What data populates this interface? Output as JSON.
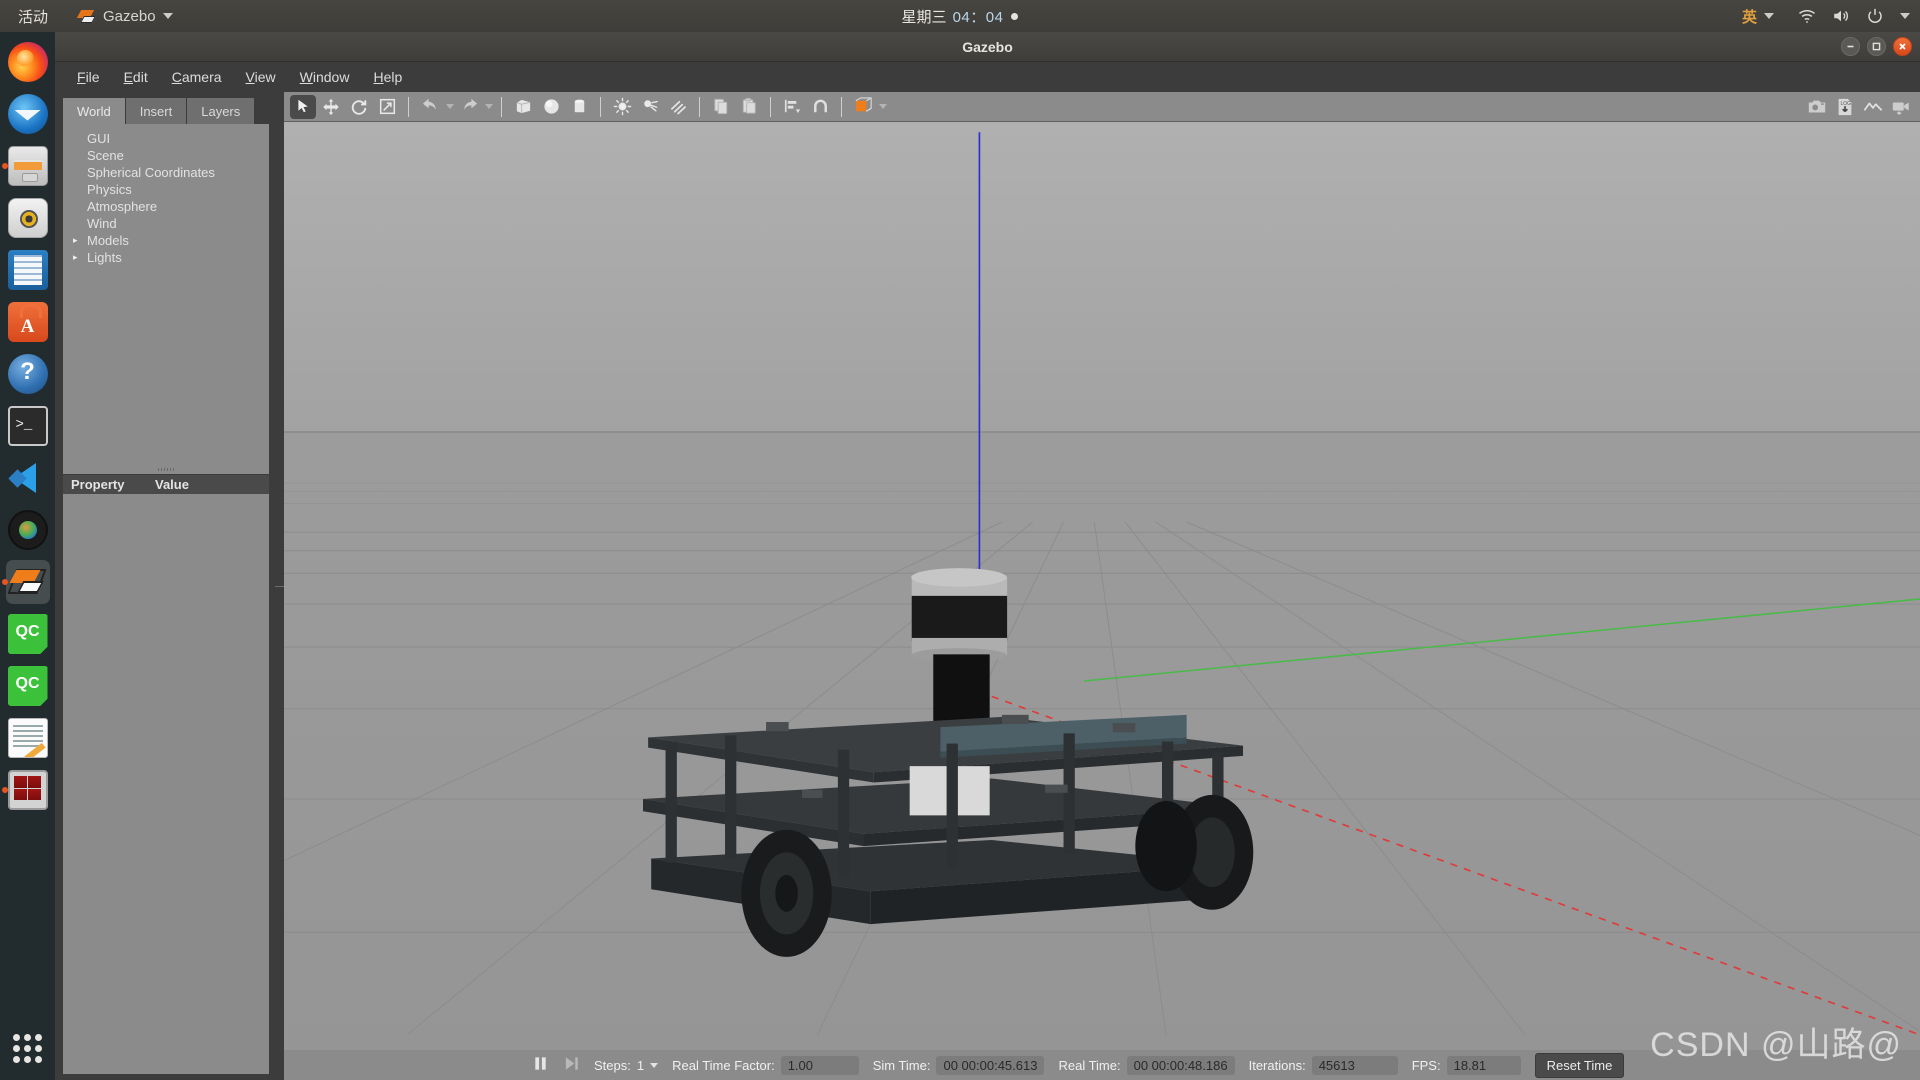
{
  "topbar": {
    "activities": "活动",
    "app_name": "Gazebo",
    "app_icon": "gazebo-icon",
    "clock_date": "星期三",
    "clock_time": "04：04",
    "notification_indicator": "notification-dot",
    "input_method": "英",
    "tray_icons": [
      "wifi-icon",
      "volume-icon",
      "power-icon"
    ],
    "bg_color": "#474540"
  },
  "dock": {
    "items": [
      {
        "name": "firefox",
        "label": "Firefox",
        "running": false,
        "active": false
      },
      {
        "name": "thunderbird",
        "label": "Thunderbird Mail",
        "running": false,
        "active": false
      },
      {
        "name": "files",
        "label": "Files",
        "running": true,
        "active": false
      },
      {
        "name": "rhythmbox",
        "label": "Rhythmbox",
        "running": false,
        "active": false
      },
      {
        "name": "libreoffice-writer",
        "label": "LibreOffice Writer",
        "running": false,
        "active": false
      },
      {
        "name": "ubuntu-software",
        "label": "Ubuntu Software",
        "running": false,
        "active": false
      },
      {
        "name": "help",
        "label": "Help",
        "running": false,
        "active": false
      },
      {
        "name": "terminal",
        "label": "Terminal",
        "running": false,
        "active": false
      },
      {
        "name": "vscode",
        "label": "Visual Studio Code",
        "running": false,
        "active": false
      },
      {
        "name": "camera",
        "label": "Cheese Webcam",
        "running": false,
        "active": false
      },
      {
        "name": "gazebo",
        "label": "Gazebo",
        "running": true,
        "active": true
      },
      {
        "name": "qc-1",
        "label": "QC",
        "running": false,
        "active": false
      },
      {
        "name": "qc-2",
        "label": "QC",
        "running": false,
        "active": false
      },
      {
        "name": "notes",
        "label": "Text Editor",
        "running": false,
        "active": false
      },
      {
        "name": "terminator",
        "label": "Terminator",
        "running": true,
        "active": false
      }
    ],
    "show_apps_label": "Show Applications"
  },
  "window": {
    "title": "Gazebo",
    "controls": [
      "minimize",
      "maximize",
      "close"
    ],
    "close_color": "#e0521d"
  },
  "menubar": {
    "items": [
      {
        "name": "file",
        "mnemonic": "F",
        "rest": "ile"
      },
      {
        "name": "edit",
        "mnemonic": "E",
        "rest": "dit"
      },
      {
        "name": "camera",
        "mnemonic": "C",
        "rest": "amera"
      },
      {
        "name": "view",
        "mnemonic": "V",
        "rest": "iew"
      },
      {
        "name": "window",
        "mnemonic": "W",
        "rest": "indow"
      },
      {
        "name": "help",
        "mnemonic": "H",
        "rest": "elp"
      }
    ]
  },
  "left_panel": {
    "tabs": [
      {
        "label": "World",
        "active": true
      },
      {
        "label": "Insert",
        "active": false
      },
      {
        "label": "Layers",
        "active": false
      }
    ],
    "tree": [
      {
        "label": "GUI",
        "expandable": false
      },
      {
        "label": "Scene",
        "expandable": false
      },
      {
        "label": "Spherical Coordinates",
        "expandable": false
      },
      {
        "label": "Physics",
        "expandable": false
      },
      {
        "label": "Atmosphere",
        "expandable": false
      },
      {
        "label": "Wind",
        "expandable": false
      },
      {
        "label": "Models",
        "expandable": true
      },
      {
        "label": "Lights",
        "expandable": true
      }
    ],
    "property_table": {
      "col_property": "Property",
      "col_value": "Value",
      "rows": []
    }
  },
  "toolbar": {
    "left_tools": [
      {
        "name": "select-mode",
        "icon": "cursor-arrow-icon",
        "active": true
      },
      {
        "name": "translate-mode",
        "icon": "move-arrows-icon",
        "active": false
      },
      {
        "name": "rotate-mode",
        "icon": "rotate-icon",
        "active": false
      },
      {
        "name": "scale-mode",
        "icon": "scale-icon",
        "active": false
      },
      {
        "name": "undo",
        "icon": "undo-arrow-icon",
        "active": false
      },
      {
        "name": "undo-history",
        "icon": "chevron-down-icon",
        "active": false
      },
      {
        "name": "redo",
        "icon": "redo-arrow-icon",
        "active": false
      },
      {
        "name": "redo-history",
        "icon": "chevron-down-icon",
        "active": false
      },
      {
        "name": "insert-box",
        "icon": "box-icon",
        "active": false
      },
      {
        "name": "insert-sphere",
        "icon": "sphere-icon",
        "active": false
      },
      {
        "name": "insert-cylinder",
        "icon": "cylinder-icon",
        "active": false
      },
      {
        "name": "insert-point-light",
        "icon": "point-light-icon",
        "active": false
      },
      {
        "name": "insert-spot-light",
        "icon": "spot-light-icon",
        "active": false
      },
      {
        "name": "insert-directional-light",
        "icon": "directional-light-icon",
        "active": false
      },
      {
        "name": "copy",
        "icon": "copy-icon",
        "active": false
      },
      {
        "name": "paste",
        "icon": "paste-icon",
        "active": false
      },
      {
        "name": "align",
        "icon": "align-icon",
        "active": false
      },
      {
        "name": "snap",
        "icon": "magnet-icon",
        "active": false
      },
      {
        "name": "view-angle",
        "icon": "orange-cube-icon",
        "active": false
      }
    ],
    "right_tools": [
      {
        "name": "screenshot",
        "icon": "camera-icon"
      },
      {
        "name": "log-data",
        "icon": "log-download-icon"
      },
      {
        "name": "plot",
        "icon": "plot-line-icon"
      },
      {
        "name": "video-record",
        "icon": "video-camera-icon"
      }
    ]
  },
  "viewport": {
    "scene_description": "Gazebo 3D viewport with grey ground plane grid, horizon, and a dark four-wheeled mobile robot with a cylindrical LIDAR sensor mounted on a black riser",
    "axis_colors": {
      "x": "#e03a3a",
      "y": "#3fbf3f",
      "z": "#2b2bd8"
    },
    "sky_color": "#acacac",
    "ground_color": "#9a9a9a"
  },
  "statusbar": {
    "play_pause_icon": "pause-icon",
    "step_icon": "step-forward-icon",
    "steps_label": "Steps:",
    "steps_value": "1",
    "rtf_label": "Real Time Factor:",
    "rtf_value": "1.00",
    "sim_time_label": "Sim Time:",
    "sim_time_value": "00 00:00:45.613",
    "real_time_label": "Real Time:",
    "real_time_value": "00 00:00:48.186",
    "iterations_label": "Iterations:",
    "iterations_value": "45613",
    "fps_label": "FPS:",
    "fps_value": "18.81",
    "reset_button": "Reset Time"
  },
  "watermark": {
    "text": "CSDN @山路@"
  }
}
